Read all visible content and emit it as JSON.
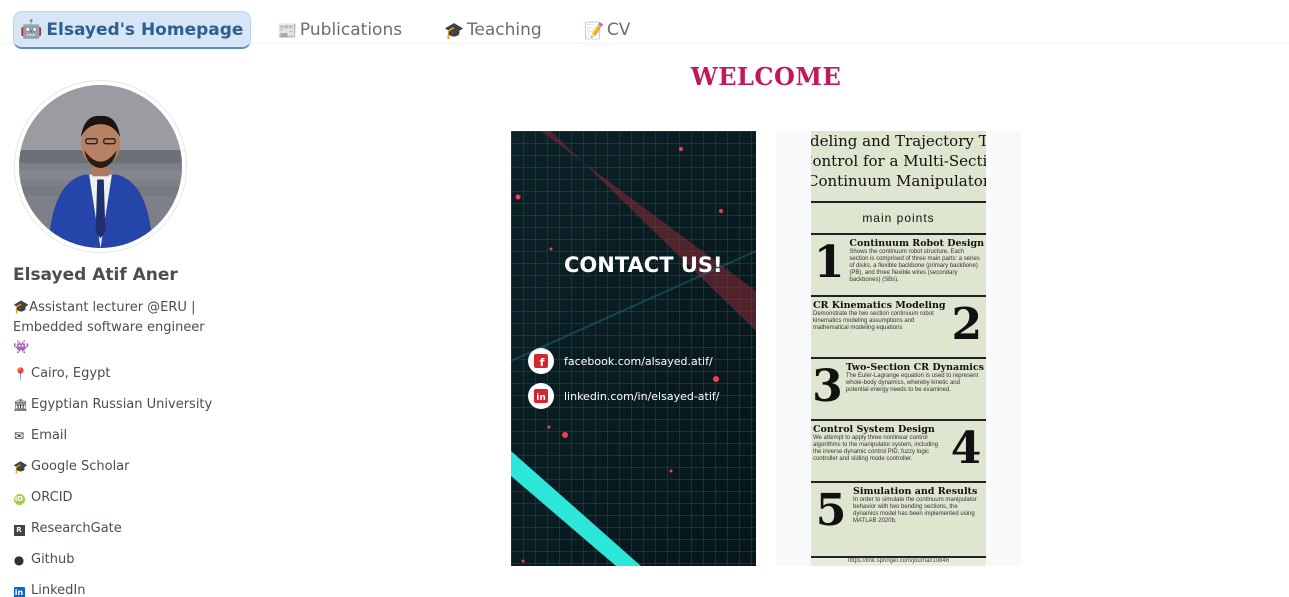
{
  "nav": {
    "brand": {
      "icon": "robot-icon",
      "label": "Elsayed's Homepage"
    },
    "links": [
      {
        "icon": "newspaper-icon",
        "label": "Publications"
      },
      {
        "icon": "graduation-cap-icon",
        "label": "Teaching"
      },
      {
        "icon": "document-icon",
        "label": "CV"
      }
    ]
  },
  "sidebar": {
    "name": "Elsayed Atif Aner",
    "bio": "🎓Assistant lecturer @ERU | Embedded software engineer 👾",
    "links": [
      {
        "icon": "map-marker-icon",
        "label": "Cairo, Egypt"
      },
      {
        "icon": "university-icon",
        "label": " Egyptian Russian University"
      },
      {
        "icon": "envelope-icon",
        "label": "Email"
      },
      {
        "icon": "google-scholar-icon",
        "label": "Google Scholar"
      },
      {
        "icon": "orcid-icon",
        "label": "ORCID"
      },
      {
        "icon": "researchgate-icon",
        "label": "ResearchGate"
      },
      {
        "icon": "github-icon",
        "label": "Github"
      },
      {
        "icon": "linkedin-icon",
        "label": "LinkedIn"
      }
    ]
  },
  "main": {
    "title": "WELCOME",
    "contact_card": {
      "heading": "CONTACT US!",
      "facebook": "facebook.com/alsayed.atif/",
      "linkedin": "linkedin.com/in/elsayed-atif/"
    },
    "poster": {
      "title_line1": "odeling and Trajectory Track",
      "title_line2": "Control for a Multi-Section",
      "title_line3": "Continuum Manipulator",
      "subtitle": "main points",
      "steps": [
        {
          "num": "1",
          "heading": "Continuum Robot Design",
          "text": "Shows the continuum robot structure. Each section is comprised of three main parts: a series of disks, a flexible backbone (primary backbone) (PB), and three flexible wires (secondary backbones) (SBs)."
        },
        {
          "num": "2",
          "heading": "CR Kinematics Modeling",
          "text": "Demonstrate the two section continuum robot kinematics modeling assumptions and mathematical modeling equations"
        },
        {
          "num": "3",
          "heading": "Two-Section CR Dynamics",
          "text": "The Euler-Lagrange equation is used to represent whole-body dynamics, whereby kinetic and potential energy needs to be examined."
        },
        {
          "num": "4",
          "heading": "Control System Design",
          "text": "We attempt to apply three nonlinear control algorithms to the manipulator system, including the inverse dynamic control PID, fuzzy logic controller and sliding mode controller."
        },
        {
          "num": "5",
          "heading": "Simulation and Results",
          "text": "In order to simulate the continuum manipulator behavior with two bending sections, the dynamics model has been implemented using MATLAB 2020b."
        }
      ],
      "footer": "https://link.springer.com/journal/10846"
    }
  }
}
